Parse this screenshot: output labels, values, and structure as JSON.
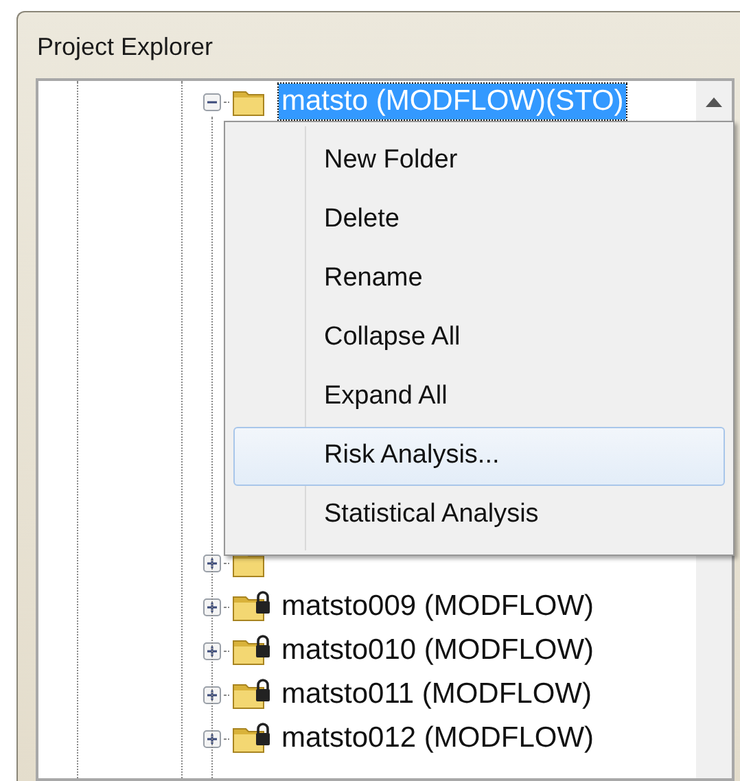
{
  "window": {
    "title": "Project Explorer"
  },
  "tree": {
    "items": [
      {
        "label": "matsto (MODFLOW)(STO)",
        "expanded": true,
        "selected": true,
        "locked": false
      },
      {
        "expanded": false,
        "locked": false
      },
      {
        "label": "matsto009 (MODFLOW)",
        "expanded": false,
        "selected": false,
        "locked": true
      },
      {
        "label": "matsto010 (MODFLOW)",
        "expanded": false,
        "selected": false,
        "locked": true
      },
      {
        "label": "matsto011 (MODFLOW)",
        "expanded": false,
        "selected": false,
        "locked": true
      },
      {
        "label": "matsto012 (MODFLOW)",
        "expanded": false,
        "selected": false,
        "locked": true
      }
    ]
  },
  "context_menu": {
    "items": [
      {
        "label": "New Folder",
        "selected": false
      },
      {
        "label": "Delete",
        "selected": false
      },
      {
        "label": "Rename",
        "selected": false
      },
      {
        "label": "Collapse All",
        "selected": false
      },
      {
        "label": "Expand All",
        "selected": false
      },
      {
        "label": "Risk Analysis...",
        "selected": true
      },
      {
        "label": "Statistical Analysis",
        "selected": false
      }
    ]
  }
}
